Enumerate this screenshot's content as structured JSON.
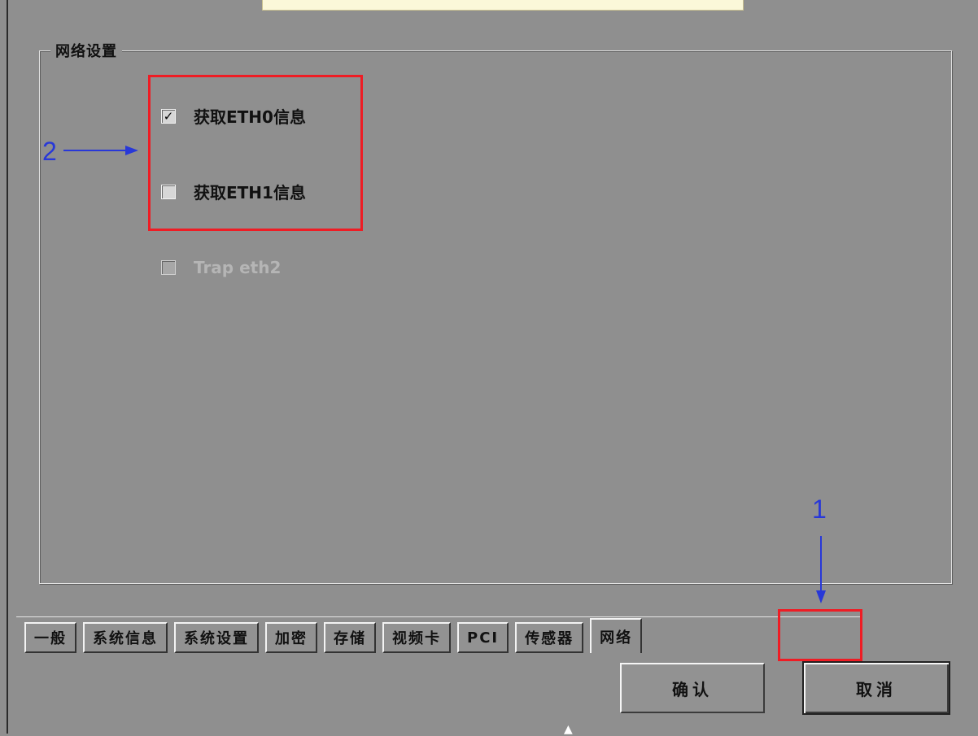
{
  "group": {
    "title": "网络设置"
  },
  "checkboxes": [
    {
      "label": "获取ETH0信息",
      "checked": true,
      "enabled": true
    },
    {
      "label": "获取ETH1信息",
      "checked": false,
      "enabled": true
    },
    {
      "label": "Trap eth2",
      "checked": false,
      "enabled": false
    }
  ],
  "tabs": [
    {
      "label": "一般"
    },
    {
      "label": "系统信息"
    },
    {
      "label": "系统设置"
    },
    {
      "label": "加密"
    },
    {
      "label": "存储"
    },
    {
      "label": "视频卡"
    },
    {
      "label": "PCI"
    },
    {
      "label": "传感器"
    },
    {
      "label": "网络",
      "active": true
    }
  ],
  "buttons": {
    "ok": "确认",
    "cancel": "取消"
  },
  "annotations": {
    "label_1": "1",
    "label_2": "2"
  },
  "colors": {
    "highlight": "#ef1c24",
    "annotation": "#2838d8",
    "panel": "#8f8f8f"
  }
}
